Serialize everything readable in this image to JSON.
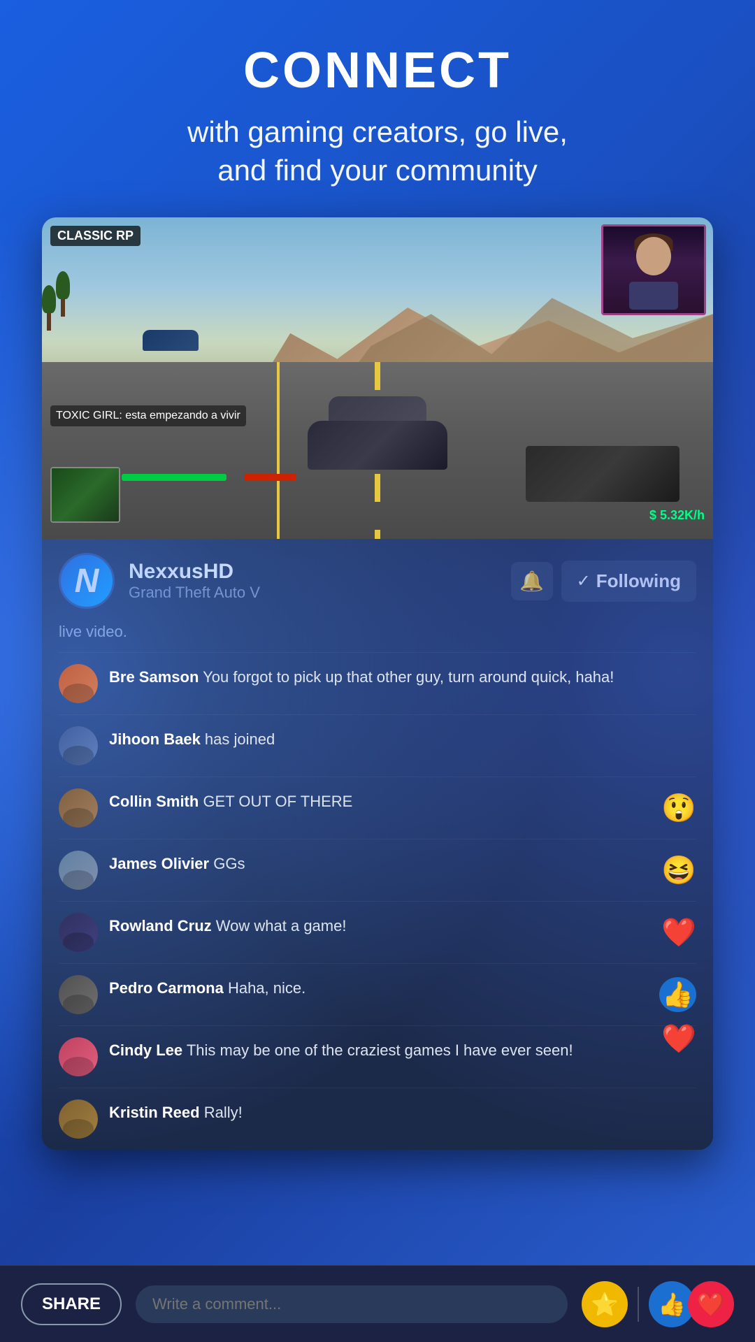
{
  "header": {
    "title": "CONNECT",
    "subtitle": "with gaming creators, go live,\nand find your community"
  },
  "video": {
    "hud_label": "CLASSIC RP",
    "chat_text": "TOXIC GIRL: esta empezando\na vivir",
    "stat_text": "$ 5.32K/h",
    "live_text": "live video."
  },
  "streamer": {
    "name": "NexxusHD",
    "game": "Grand Theft Auto V",
    "avatar_letter": "N",
    "bell_label": "🔔",
    "following_label": "Following",
    "check": "✓"
  },
  "comments": [
    {
      "name": "Bre Samson",
      "text": " You forgot to pick up that other guy, turn around quick, haha!",
      "avatar_class": "av-bre",
      "reaction": null
    },
    {
      "name": "Jihoon Baek",
      "text": " has joined",
      "avatar_class": "av-jihoon",
      "reaction": null
    },
    {
      "name": "Collin Smith",
      "text": " GET OUT OF THERE",
      "avatar_class": "av-collin",
      "reaction": "😲"
    },
    {
      "name": "James Olivier",
      "text": " GGs",
      "avatar_class": "av-james",
      "reaction": "😆"
    },
    {
      "name": "Rowland Cruz",
      "text": " Wow what a game!",
      "avatar_class": "av-rowland",
      "reaction": "❤️"
    },
    {
      "name": "Pedro Carmona",
      "text": " Haha, nice.",
      "avatar_class": "av-pedro",
      "reaction": "👍"
    },
    {
      "name": "Cindy Lee",
      "text": " This may be one of the craziest games I have ever seen!",
      "avatar_class": "av-cindy",
      "reaction": "❤️"
    },
    {
      "name": "Kristin Reed",
      "text": " Rally!",
      "avatar_class": "av-kristin",
      "reaction": null
    }
  ],
  "bottom_bar": {
    "share_label": "SHARE",
    "comment_placeholder": "Write a comment...",
    "star_emoji": "⭐",
    "like_emoji": "👍",
    "heart_emoji": "❤️"
  }
}
